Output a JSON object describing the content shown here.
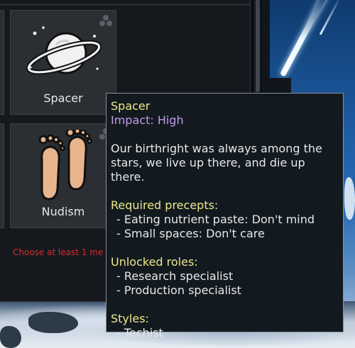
{
  "tiles": [
    {
      "name": "Spacer"
    },
    {
      "name": "Nudism"
    }
  ],
  "warning_text": "Choose at least 1 me",
  "tooltip": {
    "title": "Spacer",
    "impact": "Impact: High",
    "description": "Our birthright was always among the stars, we live up there, and die up there.",
    "required_precepts_heading": "Required precepts:",
    "required_precepts": [
      "- Eating nutrient paste: Don't mind",
      "- Small spaces: Don't care"
    ],
    "unlocked_roles_heading": "Unlocked roles:",
    "unlocked_roles": [
      "- Research specialist",
      "- Production specialist"
    ],
    "styles_heading": "Styles:",
    "styles": [
      "- Techist"
    ]
  },
  "icons": {
    "tile1": "planet-icon",
    "tile2": "footprints-icon",
    "stack": "stack-icon"
  },
  "colors": {
    "title_yellow": "#ede88a",
    "impact_purple": "#c39ae6",
    "warning_red": "#d42a2a"
  }
}
